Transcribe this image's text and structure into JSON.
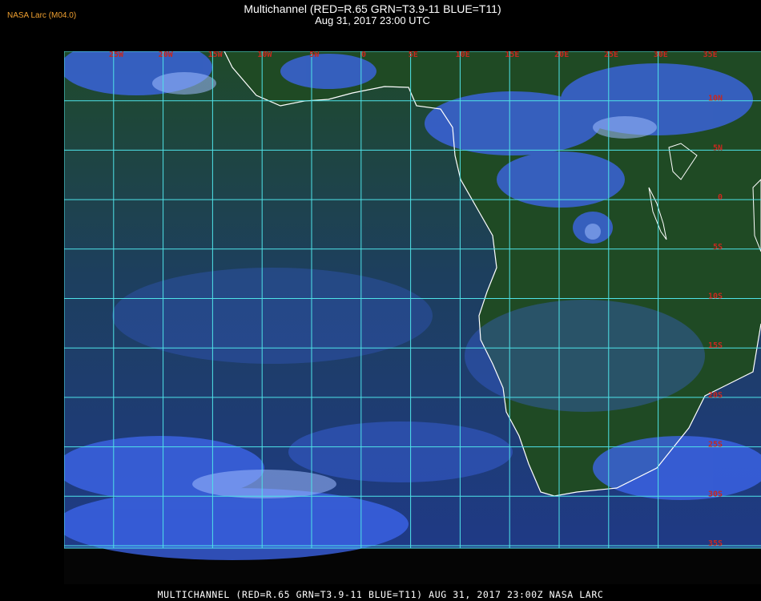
{
  "header": {
    "agency": "NASA Larc (M04.0)",
    "title": "Multichannel (RED=R.65 GRN=T3.9-11 BLUE=T11)",
    "datetime": "Aug 31, 2017 23:00 UTC"
  },
  "map": {
    "longitude_labels": [
      "25W",
      "20W",
      "15W",
      "10W",
      "5W",
      "0",
      "5E",
      "10E",
      "15E",
      "20E",
      "25E",
      "30E",
      "35E"
    ],
    "latitude_labels": [
      "10N",
      "5N",
      "0",
      "5S",
      "10S",
      "15S",
      "20S",
      "25S",
      "30S",
      "35S",
      "40S"
    ],
    "colors": {
      "grid": "#4fe3e8",
      "labels": "#c8281e",
      "coast": "#ffffff",
      "land": "#1f4a24",
      "ocean": "#1e3d7a",
      "cloud": "#3b6bff"
    }
  },
  "footer": {
    "caption": "MULTICHANNEL (RED=R.65 GRN=T3.9-11 BLUE=T11) AUG 31, 2017 23:00Z   NASA LARC"
  }
}
